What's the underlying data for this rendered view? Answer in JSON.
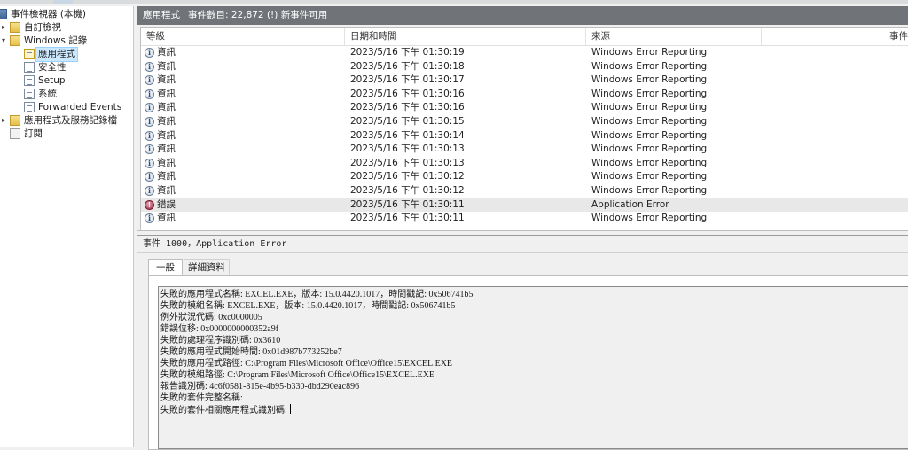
{
  "tree": {
    "root": "事件檢視器 (本機)",
    "custom_views": "自訂檢視",
    "windows_logs": "Windows 記錄",
    "logs": [
      "應用程式",
      "安全性",
      "Setup",
      "系統",
      "Forwarded Events"
    ],
    "apps_services": "應用程式及服務記錄檔",
    "subscriptions": "訂閱"
  },
  "header": {
    "log_name": "應用程式",
    "event_count": "事件數目: 22,872 (!) 新事件可用"
  },
  "grid": {
    "columns": [
      "等級",
      "日期和時間",
      "來源",
      "事件"
    ],
    "rows": [
      {
        "level": "資訊",
        "type": "info",
        "datetime": "2023/5/16 下午 01:30:19",
        "source": "Windows Error Reporting"
      },
      {
        "level": "資訊",
        "type": "info",
        "datetime": "2023/5/16 下午 01:30:18",
        "source": "Windows Error Reporting"
      },
      {
        "level": "資訊",
        "type": "info",
        "datetime": "2023/5/16 下午 01:30:17",
        "source": "Windows Error Reporting"
      },
      {
        "level": "資訊",
        "type": "info",
        "datetime": "2023/5/16 下午 01:30:16",
        "source": "Windows Error Reporting"
      },
      {
        "level": "資訊",
        "type": "info",
        "datetime": "2023/5/16 下午 01:30:16",
        "source": "Windows Error Reporting"
      },
      {
        "level": "資訊",
        "type": "info",
        "datetime": "2023/5/16 下午 01:30:15",
        "source": "Windows Error Reporting"
      },
      {
        "level": "資訊",
        "type": "info",
        "datetime": "2023/5/16 下午 01:30:14",
        "source": "Windows Error Reporting"
      },
      {
        "level": "資訊",
        "type": "info",
        "datetime": "2023/5/16 下午 01:30:13",
        "source": "Windows Error Reporting"
      },
      {
        "level": "資訊",
        "type": "info",
        "datetime": "2023/5/16 下午 01:30:13",
        "source": "Windows Error Reporting"
      },
      {
        "level": "資訊",
        "type": "info",
        "datetime": "2023/5/16 下午 01:30:12",
        "source": "Windows Error Reporting"
      },
      {
        "level": "資訊",
        "type": "info",
        "datetime": "2023/5/16 下午 01:30:12",
        "source": "Windows Error Reporting"
      },
      {
        "level": "錯誤",
        "type": "error",
        "datetime": "2023/5/16 下午 01:30:11",
        "source": "Application Error"
      },
      {
        "level": "資訊",
        "type": "info",
        "datetime": "2023/5/16 下午 01:30:11",
        "source": "Windows Error Reporting"
      }
    ]
  },
  "detail": {
    "title": "事件 1000，Application Error",
    "tabs": [
      "一般",
      "詳細資料"
    ],
    "lines": [
      "失敗的應用程式名稱: EXCEL.EXE，版本: 15.0.4420.1017，時間戳記: 0x506741b5",
      "失敗的模組名稱: EXCEL.EXE，版本: 15.0.4420.1017，時間戳記: 0x506741b5",
      "例外狀況代碼: 0xc0000005",
      "錯誤位移: 0x0000000000352a9f",
      "失敗的處理程序識別碼: 0x3610",
      "失敗的應用程式開始時間: 0x01d987b773252be7",
      "失敗的應用程式路徑: C:\\Program Files\\Microsoft Office\\Office15\\EXCEL.EXE",
      "失敗的模組路徑: C:\\Program Files\\Microsoft Office\\Office15\\EXCEL.EXE",
      "報告識別碼: 4c6f0581-815e-4b95-b330-dbd290eac896",
      "失敗的套件完整名稱:",
      "失敗的套件相關應用程式識別碼:"
    ]
  },
  "icons": {
    "info": "information-icon",
    "error": "error-icon"
  }
}
